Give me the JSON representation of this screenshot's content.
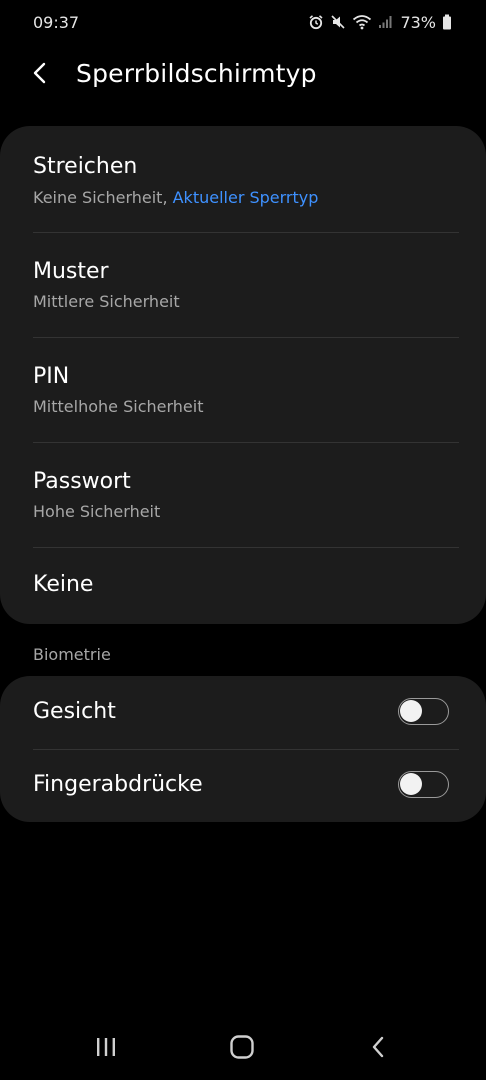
{
  "status_bar": {
    "time": "09:37",
    "battery": "73%",
    "icons": [
      "alarm-icon",
      "mute-icon",
      "wifi-icon",
      "signal-icon",
      "battery-icon"
    ]
  },
  "header": {
    "title": "Sperrbildschirmtyp",
    "back_icon": "back-arrow-icon"
  },
  "lock_types": [
    {
      "title": "Streichen",
      "subtitle": "Keine Sicherheit, ",
      "current_label": "Aktueller Sperrtyp"
    },
    {
      "title": "Muster",
      "subtitle": "Mittlere Sicherheit"
    },
    {
      "title": "PIN",
      "subtitle": "Mittelhohe Sicherheit"
    },
    {
      "title": "Passwort",
      "subtitle": "Hohe Sicherheit"
    },
    {
      "title": "Keine"
    }
  ],
  "biometrics": {
    "section_label": "Biometrie",
    "items": [
      {
        "label": "Gesicht",
        "enabled": false
      },
      {
        "label": "Fingerabdrücke",
        "enabled": false
      }
    ]
  },
  "colors": {
    "background": "#000000",
    "card": "#1c1c1c",
    "accent": "#3e91ff",
    "secondary_text": "#a7a7a7"
  },
  "nav_bar": {
    "icons": [
      "recent-apps-icon",
      "home-icon",
      "back-icon"
    ]
  }
}
